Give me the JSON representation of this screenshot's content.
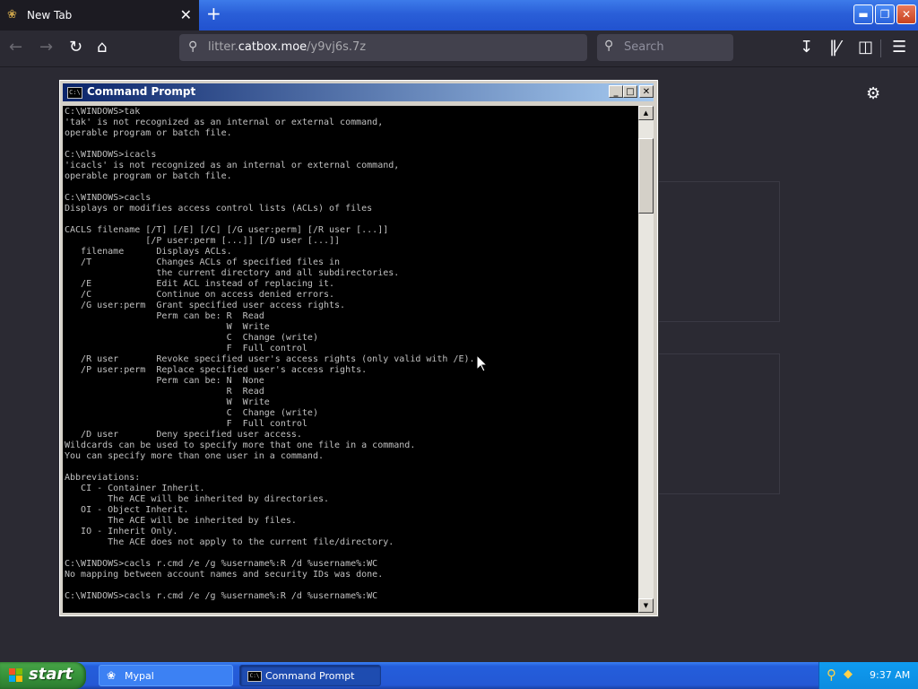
{
  "browser": {
    "tab_title": "New Tab",
    "tab_icon": "mypal-icon",
    "url_host_prefix": "litter.",
    "url_host": "catbox.moe",
    "url_path": "/y9vj6s.7z",
    "search_placeholder": "Search"
  },
  "cmd": {
    "title": "Command Prompt",
    "icon_text": "C:\\",
    "output": "C:\\WINDOWS>tak\n'tak' is not recognized as an internal or external command,\noperable program or batch file.\n\nC:\\WINDOWS>icacls\n'icacls' is not recognized as an internal or external command,\noperable program or batch file.\n\nC:\\WINDOWS>cacls\nDisplays or modifies access control lists (ACLs) of files\n\nCACLS filename [/T] [/E] [/C] [/G user:perm] [/R user [...]]\n               [/P user:perm [...]] [/D user [...]]\n   filename      Displays ACLs.\n   /T            Changes ACLs of specified files in\n                 the current directory and all subdirectories.\n   /E            Edit ACL instead of replacing it.\n   /C            Continue on access denied errors.\n   /G user:perm  Grant specified user access rights.\n                 Perm can be: R  Read\n                              W  Write\n                              C  Change (write)\n                              F  Full control\n   /R user       Revoke specified user's access rights (only valid with /E).\n   /P user:perm  Replace specified user's access rights.\n                 Perm can be: N  None\n                              R  Read\n                              W  Write\n                              C  Change (write)\n                              F  Full control\n   /D user       Deny specified user access.\nWildcards can be used to specify more that one file in a command.\nYou can specify more than one user in a command.\n\nAbbreviations:\n   CI - Container Inherit.\n        The ACE will be inherited by directories.\n   OI - Object Inherit.\n        The ACE will be inherited by files.\n   IO - Inherit Only.\n        The ACE does not apply to the current file/directory.\n\nC:\\WINDOWS>cacls r.cmd /e /g %username%:R /d %username%:WC\nNo mapping between account names and security IDs was done.\n\nC:\\WINDOWS>cacls r.cmd /e /g %username%:R /d %username%:WC"
  },
  "taskbar": {
    "start_label": "start",
    "tasks": [
      {
        "label": "Mypal",
        "icon": "mypal-icon"
      },
      {
        "label": "Command Prompt",
        "icon": "cmd-icon",
        "icon_text": "C:\\"
      }
    ],
    "clock": "9:37 AM"
  },
  "colors": {
    "console_bg": "#000000",
    "console_fg": "#c0c0c0",
    "titlebar_active": "#0a246a",
    "taskbar": "#245edb",
    "start_green": "#37933a",
    "firefox_dark": "#2b2a33"
  }
}
